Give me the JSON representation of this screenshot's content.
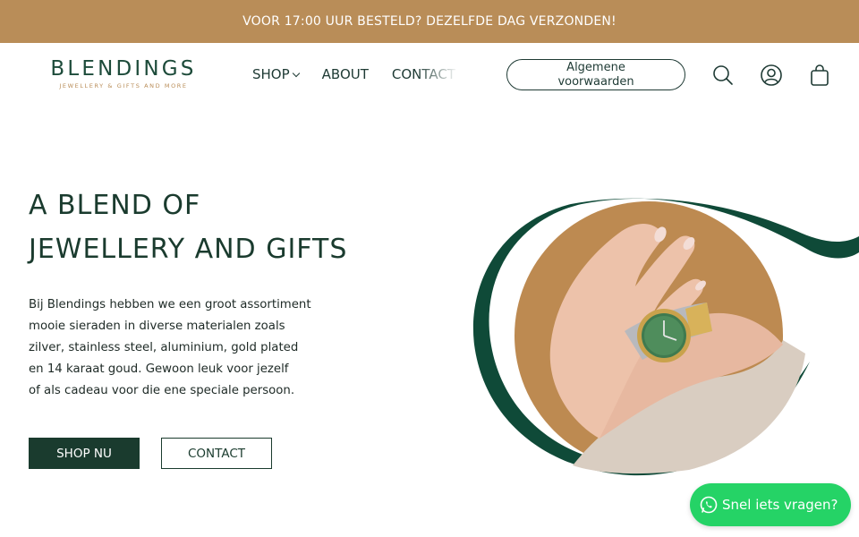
{
  "announcement": {
    "text": "VOOR 17:00 UUR BESTELD? DEZELFDE DAG VERZONDEN!"
  },
  "brand": {
    "name": "BLENDINGS",
    "tagline": "JEWELLERY & GIFTS AND MORE"
  },
  "nav": {
    "items": [
      {
        "label": "SHOP",
        "has_dropdown": true
      },
      {
        "label": "ABOUT"
      },
      {
        "label": "CONTACT"
      }
    ]
  },
  "header": {
    "terms_button": "Algemene voorwaarden",
    "icons": [
      "search-icon",
      "account-icon",
      "cart-icon"
    ]
  },
  "hero": {
    "title_line1": "A BLEND OF",
    "title_line2": "JEWELLERY AND GIFTS",
    "paragraph": [
      "Bij Blendings hebben we een groot assortiment",
      "mooie sieraden in diverse materialen zoals",
      "zilver, stainless steel, aluminium, gold plated",
      "en 14 karaat goud. Gewoon leuk voor jezelf",
      "of als cadeau voor die ene speciale persoon."
    ],
    "primary_button": "SHOP NU",
    "secondary_button": "CONTACT",
    "image_subject": "wrist-watch-photo"
  },
  "whatsapp": {
    "label": "Snel iets vragen?",
    "icon": "whatsapp-icon"
  },
  "colors": {
    "announcement_bg": "#b98d58",
    "brand_green": "#1a3b2e",
    "accent_gold": "#b98d58",
    "whatsapp_green": "#25d366"
  }
}
